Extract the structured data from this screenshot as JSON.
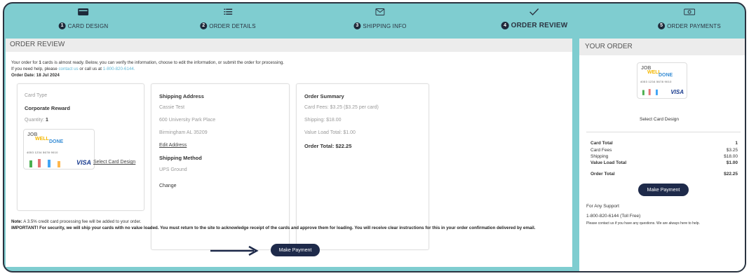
{
  "steps": [
    {
      "num": "1",
      "label": "CARD DESIGN",
      "icon": "card-icon"
    },
    {
      "num": "2",
      "label": "ORDER DETAILS",
      "icon": "list-icon"
    },
    {
      "num": "3",
      "label": "SHIPPING INFO",
      "icon": "mail-icon"
    },
    {
      "num": "4",
      "label": "ORDER REVIEW",
      "icon": "checkmark-icon"
    },
    {
      "num": "5",
      "label": "ORDER PAYMENTS",
      "icon": "cash-icon"
    }
  ],
  "colors": {
    "frame": "#7fcdd0",
    "button": "#1e2a4a",
    "link": "#5fb8d6",
    "header": "#ececec"
  },
  "review": {
    "title": "ORDER REVIEW",
    "intro_prefix": "Your order for ",
    "intro_count": "1",
    "intro_suffix": " cards is almost ready. Below, you can verify the information, choose to edit the information, or submit the order for processing.",
    "help_prefix": "If you need help, please ",
    "help_link": "contact us",
    "help_mid": " or call us at ",
    "help_phone": "1-800-820-6144.",
    "order_date": "Order Date: 18 Jul 2024"
  },
  "card_box": {
    "type_label": "Card Type",
    "type_value": "Corporate Reward",
    "qty_label": "Quantity: ",
    "qty_value": "1",
    "select_link": "Select Card Design"
  },
  "card_art": {
    "job": "JOB",
    "well": "WELL",
    "done": "DONE",
    "digits": "4053 1234 5678 9010",
    "visa": "VISA"
  },
  "shipping": {
    "heading": "Shipping Address",
    "name": "Cassie Test",
    "street": "600 University Park Place",
    "city": "Birmingham AL 35209",
    "edit_link": "Edit Address",
    "method_heading": "Shipping Method",
    "method": "UPS Ground",
    "change_link": "Change"
  },
  "summary": {
    "heading": "Order Summary",
    "card_fees": "Card Fees: $3.25 ($3.25 per card)",
    "shipping": "Shipping: $18.00",
    "value_load": "Value Load Total: $1.00",
    "total": "Order Total: $22.25"
  },
  "notes": {
    "note_label": "Note:",
    "note_text": " A 3.5% credit card processing fee will be added to your order.",
    "important": "IMPORTANT! For security, we will ship your cards with no value loaded. You must return to the site to acknowledge receipt of the cards and approve them for loading. You will receive clear instructions for this in your order confirmation delivered by email."
  },
  "make_payment": "Make Payment",
  "side": {
    "title": "YOUR ORDER",
    "select_design": "Select Card Design",
    "rows": [
      {
        "label": "Card Total",
        "value": "1",
        "bold": true
      },
      {
        "label": "Card Fees",
        "value": "$3.25",
        "bold": false
      },
      {
        "label": "Shipping",
        "value": "$18.00",
        "bold": false
      },
      {
        "label": "Value Load Total",
        "value": "$1.00",
        "bold": true
      },
      {
        "label": "Order Total",
        "value": "$22.25",
        "bold": true
      }
    ],
    "support_heading": "For Any Support",
    "support_phone": "1-800-820-6144 (Toll Free)",
    "support_text": "Please contact us if you have any questions. We are always here to help."
  }
}
